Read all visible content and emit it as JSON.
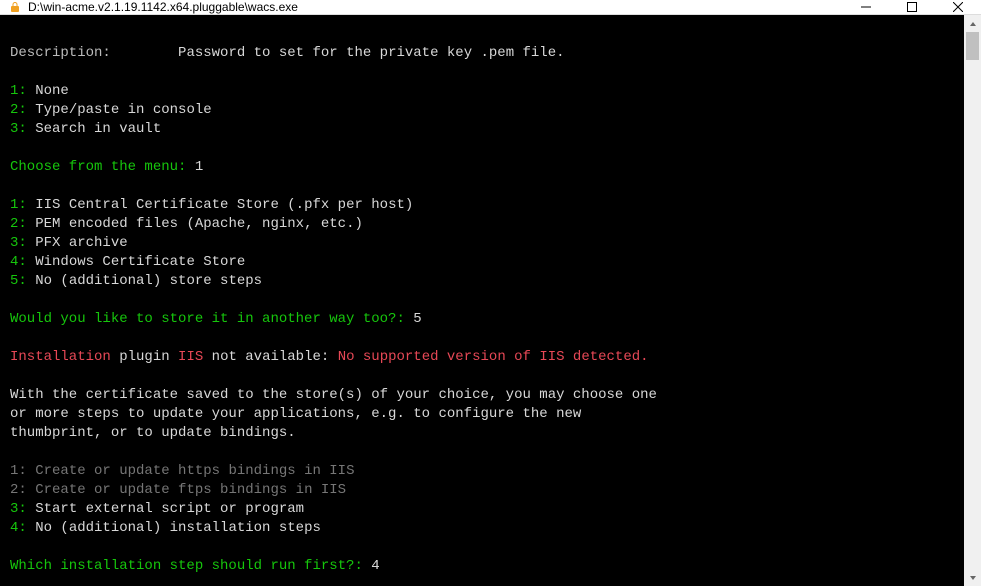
{
  "window": {
    "title": "D:\\win-acme.v2.1.19.1142.x64.pluggable\\wacs.exe"
  },
  "term": {
    "desc_label": "Description:",
    "desc_text": "Password to set for the private key .pem file.",
    "menu1": {
      "i1": "1:",
      "t1": "None",
      "i2": "2:",
      "t2": "Type/paste in console",
      "i3": "3:",
      "t3": "Search in vault"
    },
    "prompt1": "Choose from the menu:",
    "prompt1_ans": "1",
    "menu2": {
      "i1": "1:",
      "t1": "IIS Central Certificate Store (.pfx per host)",
      "i2": "2:",
      "t2": "PEM encoded files (Apache, nginx, etc.)",
      "i3": "3:",
      "t3": "PFX archive",
      "i4": "4:",
      "t4": "Windows Certificate Store",
      "i5": "5:",
      "t5": "No (additional) store steps"
    },
    "prompt2": "Would you like to store it in another way too?:",
    "prompt2_ans": "5",
    "err_install": "Installation",
    "err_plugin": " plugin ",
    "err_iis": "IIS",
    "err_notavail": " not available: ",
    "err_msg": "No supported version of IIS detected.",
    "para_l1": "With the certificate saved to the store(s) of your choice, you may choose one",
    "para_l2": "or more steps to update your applications, e.g. to configure the new",
    "para_l3": "thumbprint, or to update bindings.",
    "menu3": {
      "i1": "1:",
      "t1": "Create or update https bindings in IIS",
      "i2": "2:",
      "t2": "Create or update ftps bindings in IIS",
      "i3": "3:",
      "t3": "Start external script or program",
      "i4": "4:",
      "t4": "No (additional) installation steps"
    },
    "prompt3": "Which installation step should run first?:",
    "prompt3_ans": "4"
  }
}
